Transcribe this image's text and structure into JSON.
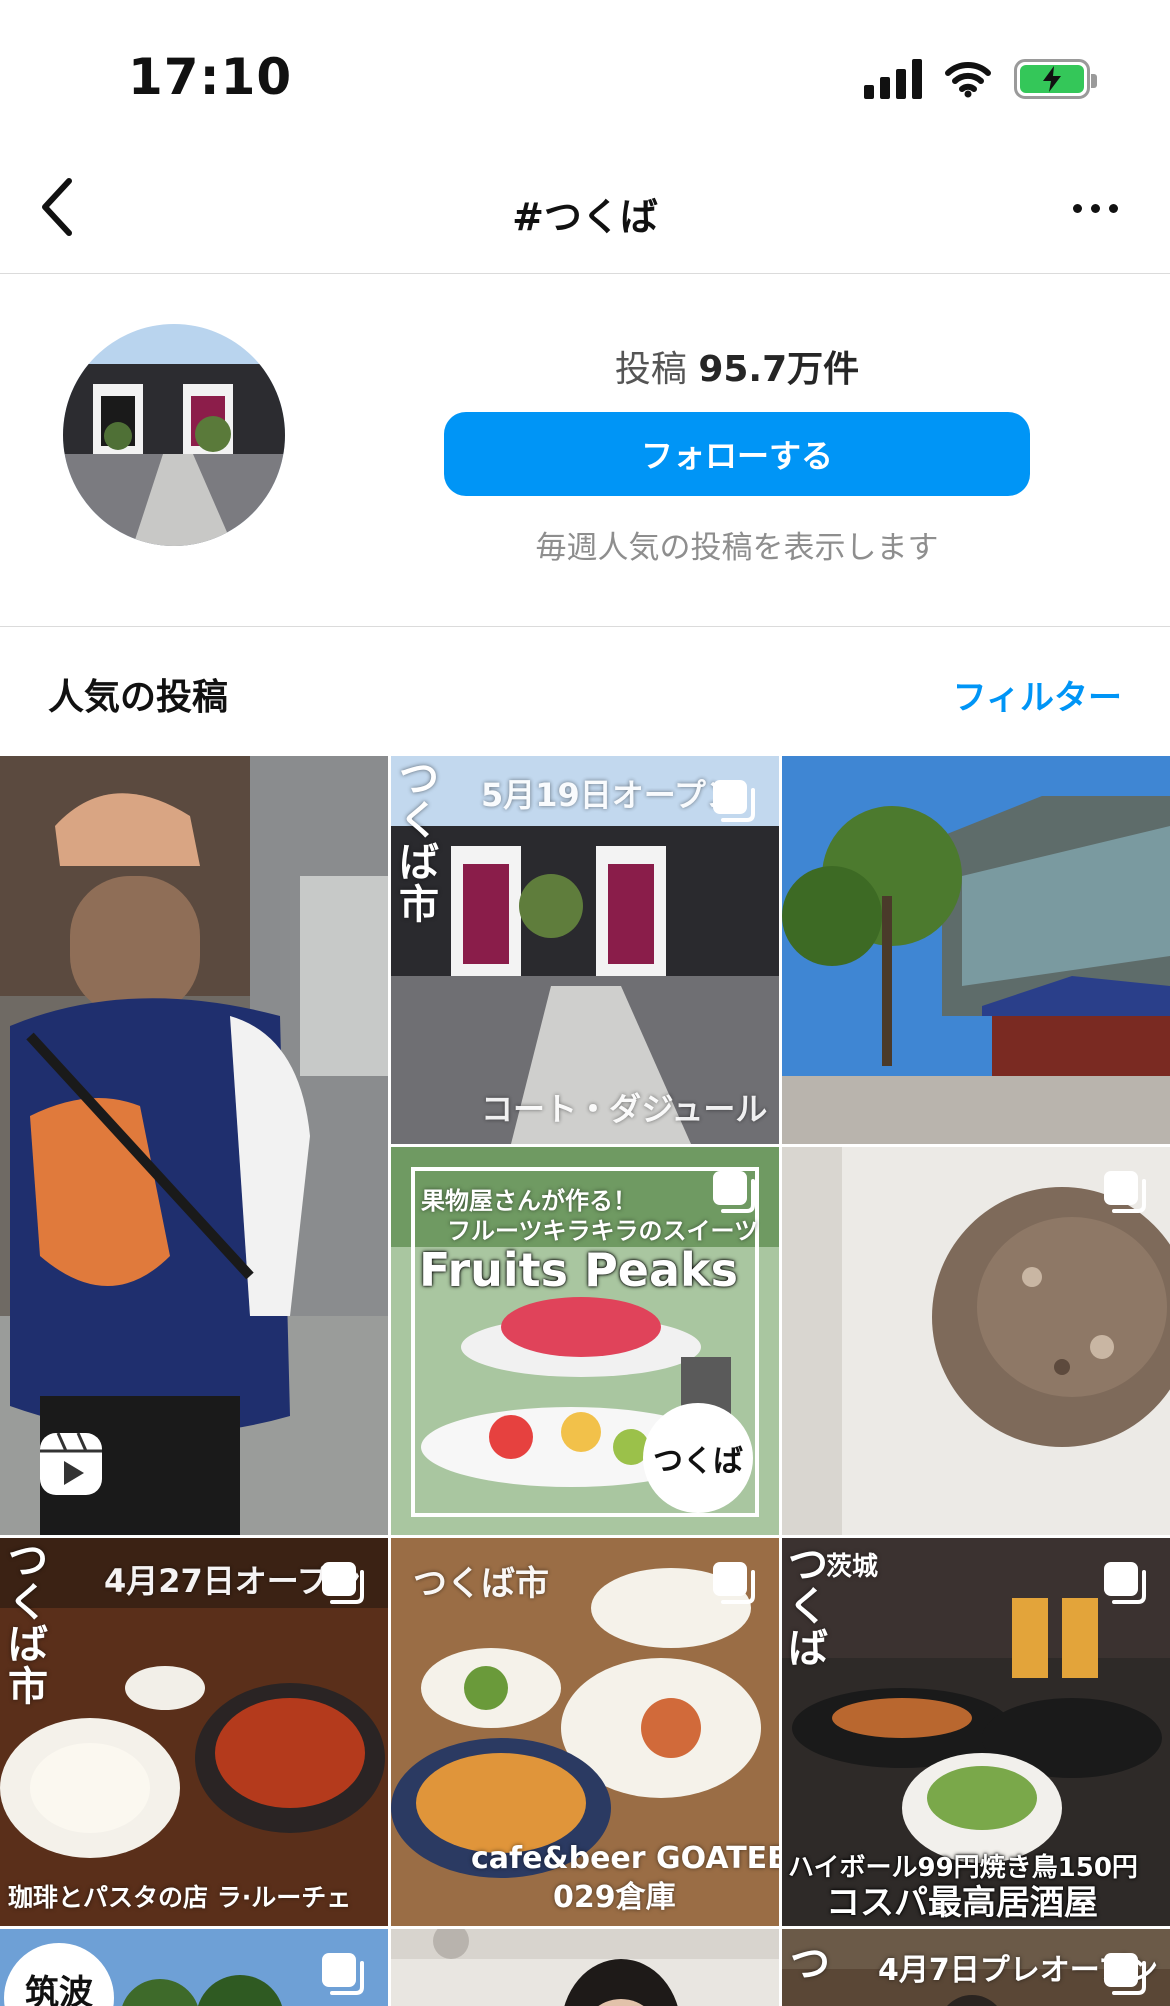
{
  "status_bar": {
    "time": "17:10"
  },
  "nav": {
    "title": "#つくば"
  },
  "header": {
    "posts_label": "投稿",
    "posts_count": "95.7万件",
    "follow_label": "フォローする",
    "subtitle": "毎週人気の投稿を表示します"
  },
  "section": {
    "title": "人気の投稿",
    "filter_label": "フィルター"
  },
  "tiles": {
    "t2": {
      "vertical": "つくば市",
      "top": "5月19日オープン",
      "bottom": "コート・ダジュール"
    },
    "t5": {
      "line1": "果物屋さんが作る！",
      "line2": "フルーツキラキラのスイーツ",
      "title": "Fruits Peaks",
      "badge": "つくば"
    },
    "t7": {
      "vertical": "つくば市",
      "top": "4月27日オープン",
      "bottom": "珈琲とパスタの店 ラ·ルーチェ"
    },
    "t8": {
      "top": "つくば市",
      "bottom1": "cafe&beer GOATEE",
      "bottom2": "029倉庫"
    },
    "t9": {
      "top_small": "茨城",
      "vertical": "つくば",
      "bottom1": "ハイボール99円焼き鳥150円",
      "bottom2": "コスパ最高居酒屋"
    },
    "t10": {
      "badge": "筑波"
    },
    "t12": {
      "vertical": "つ",
      "top": "4月7日プレオープン"
    }
  }
}
